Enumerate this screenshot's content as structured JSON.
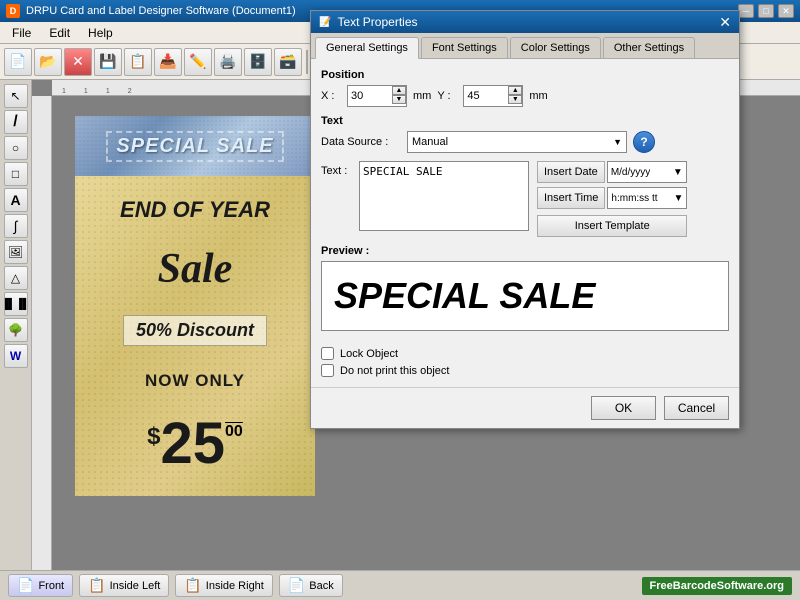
{
  "window": {
    "title": "DRPU Card and Label Designer Software (Document1)",
    "icon": "D"
  },
  "titlebar_controls": {
    "minimize": "─",
    "maximize": "□",
    "close": "✕"
  },
  "menu": {
    "items": [
      "File",
      "Edit",
      "Help"
    ]
  },
  "dialog": {
    "title": "Text Properties",
    "tabs": [
      "General Settings",
      "Font Settings",
      "Color Settings",
      "Other Settings"
    ],
    "active_tab": "General Settings",
    "position": {
      "label_x": "X :",
      "value_x": "30",
      "label_y": "Y :",
      "value_y": "45",
      "unit": "mm"
    },
    "text_section": {
      "label_datasource": "Data Source :",
      "datasource_value": "Manual",
      "label_text": "Text :",
      "text_value": "SPECIAL SALE"
    },
    "buttons": {
      "insert_date": "Insert Date",
      "insert_date_format": "M/d/yyyy",
      "insert_time": "Insert Time",
      "insert_time_format": "h:mm:ss tt",
      "insert_template": "Insert Template"
    },
    "preview": {
      "label": "Preview :",
      "text": "SPECIAL SALE"
    },
    "checkboxes": {
      "lock_object": "Lock Object",
      "no_print": "Do not print this object"
    },
    "footer": {
      "ok": "OK",
      "cancel": "Cancel"
    }
  },
  "label": {
    "top_text": "SPECIAL SALE",
    "line1": "END OF YEAR",
    "line2": "Sale",
    "discount": "50% Discount",
    "now_only": "NOW ONLY",
    "dollar": "$",
    "price_main": "25",
    "price_cents": "00"
  },
  "bottom_tabs": {
    "front": "Front",
    "inside_left": "Inside Left",
    "inside_right": "Inside Right",
    "back": "Back"
  },
  "brand": "FreeBarcodeSoftware.org",
  "section_labels": {
    "position": "Position",
    "text": "Text",
    "preview": "Preview :"
  }
}
